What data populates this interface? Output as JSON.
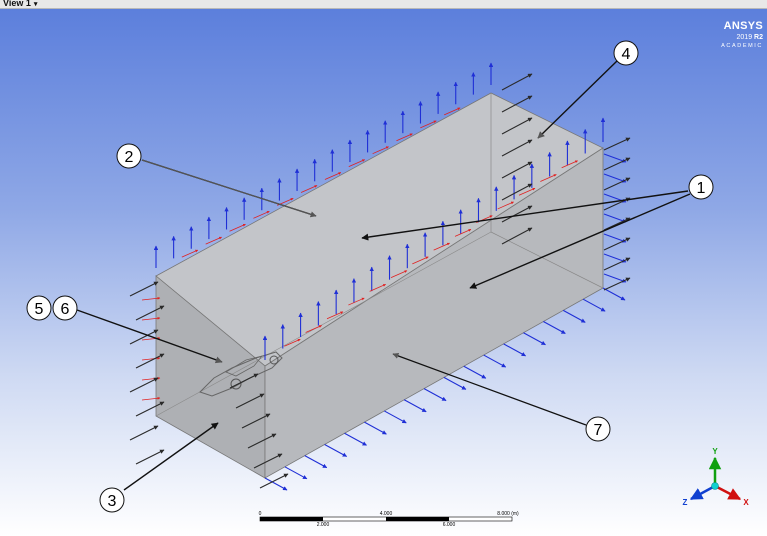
{
  "window": {
    "title": "View 1"
  },
  "logo": {
    "name": "ANSYS",
    "version": "2019",
    "release": "R2",
    "edition": "ACADEMIC"
  },
  "callouts": [
    {
      "id": "c1",
      "label": "1"
    },
    {
      "id": "c2",
      "label": "2"
    },
    {
      "id": "c3",
      "label": "3"
    },
    {
      "id": "c4",
      "label": "4"
    },
    {
      "id": "c5",
      "label": "5"
    },
    {
      "id": "c6",
      "label": "6"
    },
    {
      "id": "c7",
      "label": "7"
    }
  ],
  "scale_bar": {
    "top_labels": [
      "0",
      "4.000",
      "8.000 (m)"
    ],
    "bottom_labels": [
      "2.000",
      "6.000"
    ]
  },
  "triad": {
    "y": "Y",
    "x": "X",
    "z": "Z"
  },
  "colors": {
    "body": "#b4b6ba",
    "normal_arrow": "#1f2fd6",
    "shear_arrow": "#e02020",
    "outflow_arrow": "#2a2a2a",
    "callout_line": "#111111",
    "callout_line_inside": "#555555",
    "triad_x": "#d01010",
    "triad_y": "#10a010",
    "triad_z": "#1040d0",
    "triad_origin": "#10d0d0"
  }
}
